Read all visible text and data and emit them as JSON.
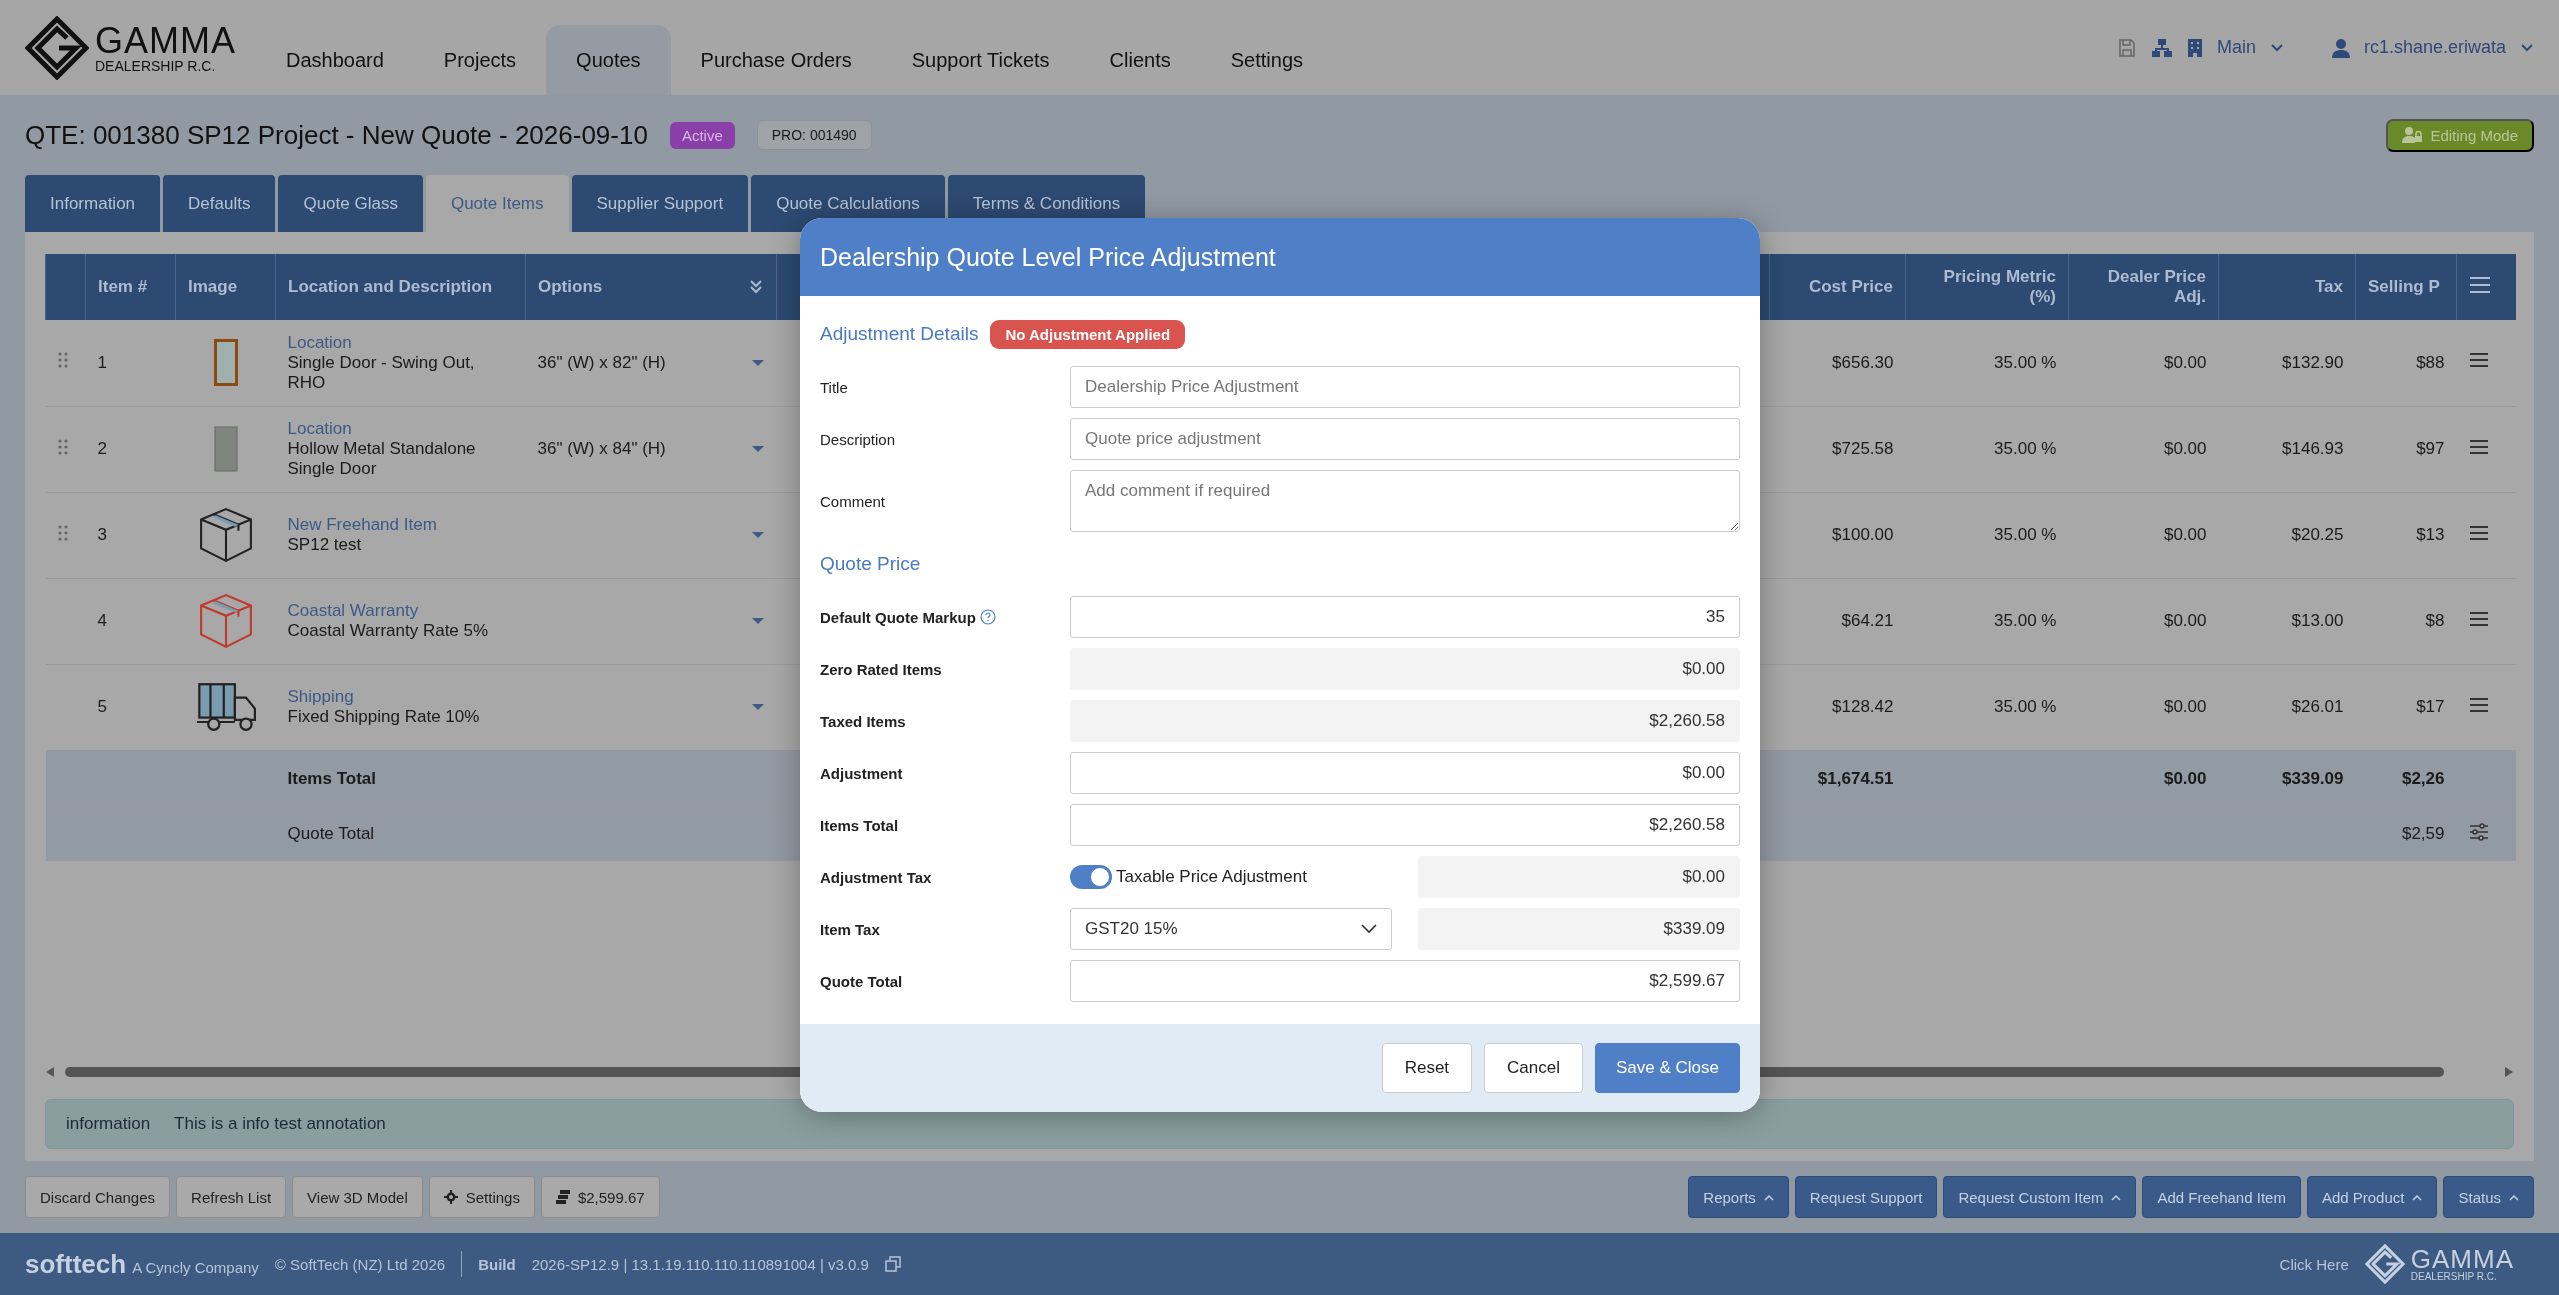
{
  "app": {
    "logo": {
      "name": "GAMMA",
      "subtitle": "DEALERSHIP R.C."
    },
    "nav": [
      {
        "label": "Dashboard",
        "selected": false
      },
      {
        "label": "Projects",
        "selected": false
      },
      {
        "label": "Quotes",
        "selected": true
      },
      {
        "label": "Purchase Orders",
        "selected": false
      },
      {
        "label": "Support Tickets",
        "selected": false
      },
      {
        "label": "Clients",
        "selected": false
      },
      {
        "label": "Settings",
        "selected": false
      }
    ],
    "branch": "Main",
    "user": "rc1.shane.eriwata"
  },
  "page": {
    "title": "QTE: 001380 SP12 Project - New Quote - 2026-09-10",
    "status": "Active",
    "project_ref": "PRO: 001490",
    "mode": "Editing Mode"
  },
  "tabs": [
    {
      "label": "Information",
      "selected": false
    },
    {
      "label": "Defaults",
      "selected": false
    },
    {
      "label": "Quote Glass",
      "selected": false
    },
    {
      "label": "Quote Items",
      "selected": true
    },
    {
      "label": "Supplier Support",
      "selected": false
    },
    {
      "label": "Quote Calculations",
      "selected": false
    },
    {
      "label": "Terms & Conditions",
      "selected": false
    }
  ],
  "table": {
    "columns": [
      "Item #",
      "Image",
      "Location and Description",
      "Options",
      "Cost Price",
      "Pricing Metric (%)",
      "Dealer Price Adj.",
      "Tax",
      "Selling P"
    ],
    "rows": [
      {
        "kind": "door",
        "draggable": true,
        "number": "1",
        "location": "Location",
        "description": "Single Door - Swing Out, RHO",
        "options": "36\" (W) x 82\" (H)",
        "cost_price": "$656.30",
        "pricing_metric": "35.00 %",
        "dealer_adj": "$0.00",
        "tax": "$132.90",
        "selling": "$88"
      },
      {
        "kind": "metal-door",
        "draggable": true,
        "number": "2",
        "location": "Location",
        "description": "Hollow Metal Standalone Single Door",
        "options": "36\" (W) x 84\" (H)",
        "cost_price": "$725.58",
        "pricing_metric": "35.00 %",
        "dealer_adj": "$0.00",
        "tax": "$146.93",
        "selling": "$97"
      },
      {
        "kind": "box",
        "draggable": true,
        "number": "3",
        "location": "New Freehand Item",
        "description": "SP12 test",
        "cost_price": "$100.00",
        "pricing_metric": "35.00 %",
        "dealer_adj": "$0.00",
        "tax": "$20.25",
        "selling": "$13"
      },
      {
        "kind": "warranty",
        "draggable": false,
        "number": "4",
        "location": "Coastal Warranty",
        "description": "Coastal Warranty Rate 5%",
        "cost_price": "$64.21",
        "pricing_metric": "35.00 %",
        "dealer_adj": "$0.00",
        "tax": "$13.00",
        "selling": "$8"
      },
      {
        "kind": "truck",
        "draggable": false,
        "number": "5",
        "location": "Shipping",
        "description": "Fixed Shipping Rate 10%",
        "cost_price": "$128.42",
        "pricing_metric": "35.00 %",
        "dealer_adj": "$0.00",
        "tax": "$26.01",
        "selling": "$17"
      }
    ],
    "totals": [
      {
        "kind": "items",
        "label": "Items Total",
        "cost_price": "$1,674.51",
        "dealer_adj": "$0.00",
        "tax": "$339.09",
        "selling": "$2,26"
      },
      {
        "kind": "quote",
        "label": "Quote Total",
        "selling": "$2,59"
      }
    ]
  },
  "annotation": {
    "type": "information",
    "text": "This is a info test annotation"
  },
  "toolbar": {
    "left": [
      {
        "kind": "plain",
        "label": "Discard Changes"
      },
      {
        "kind": "plain",
        "label": "Refresh List"
      },
      {
        "kind": "plain",
        "label": "View 3D Model"
      },
      {
        "kind": "gear",
        "label": "Settings"
      },
      {
        "kind": "stack",
        "label": "$2,599.67"
      }
    ],
    "right": [
      {
        "label": "Reports",
        "caret": true
      },
      {
        "label": "Request Support",
        "caret": false
      },
      {
        "label": "Request Custom Item",
        "caret": true
      },
      {
        "label": "Add Freehand Item",
        "caret": false
      },
      {
        "label": "Add Product",
        "caret": true
      },
      {
        "label": "Status",
        "caret": true
      }
    ]
  },
  "footer": {
    "brand": "softtech",
    "brand_tagline": "A Cyncly Company",
    "copyright": "© SoftTech (NZ) Ltd 2026",
    "build_label": "Build",
    "build": "2026-SP12.9 | 13.1.19.110.110.110891004 | v3.0.9",
    "link": "Click Here",
    "logo": {
      "name": "GAMMA",
      "subtitle": "DEALERSHIP R.C."
    }
  },
  "modal": {
    "title": "Dealership Quote Level Price Adjustment",
    "section_1": "Adjustment Details",
    "badge": "No Adjustment Applied",
    "details": [
      {
        "kind": "input",
        "label": "Title",
        "placeholder": "Dealership Price Adjustment"
      },
      {
        "kind": "input",
        "label": "Description",
        "placeholder": "Quote price adjustment"
      },
      {
        "kind": "textarea",
        "label": "Comment",
        "placeholder": "Add comment if required"
      }
    ],
    "section_2": "Quote Price",
    "fields": [
      {
        "kind": "input",
        "label": "Default Quote Markup",
        "help": true,
        "value": "35"
      },
      {
        "kind": "readonly",
        "label": "Zero Rated Items",
        "help": false,
        "value": "$0.00"
      },
      {
        "kind": "readonly",
        "label": "Taxed Items",
        "help": false,
        "value": "$2,260.58"
      },
      {
        "kind": "input",
        "label": "Adjustment",
        "help": false,
        "value": "$0.00"
      },
      {
        "kind": "input",
        "label": "Items Total",
        "help": false,
        "value": "$2,260.58"
      },
      {
        "kind": "toggle",
        "label": "Adjustment Tax",
        "help": false,
        "toggle_label": "Taxable Price Adjustment",
        "on": true,
        "value": "$0.00"
      },
      {
        "kind": "select",
        "label": "Item Tax",
        "help": false,
        "option": "GST20 15%",
        "value": "$339.09"
      },
      {
        "kind": "input",
        "label": "Quote Total",
        "help": false,
        "value": "$2,599.67"
      }
    ],
    "buttons": [
      {
        "kind": "secondary",
        "label": "Reset"
      },
      {
        "kind": "secondary",
        "label": "Cancel"
      },
      {
        "kind": "primary",
        "label": "Save & Close"
      }
    ]
  }
}
